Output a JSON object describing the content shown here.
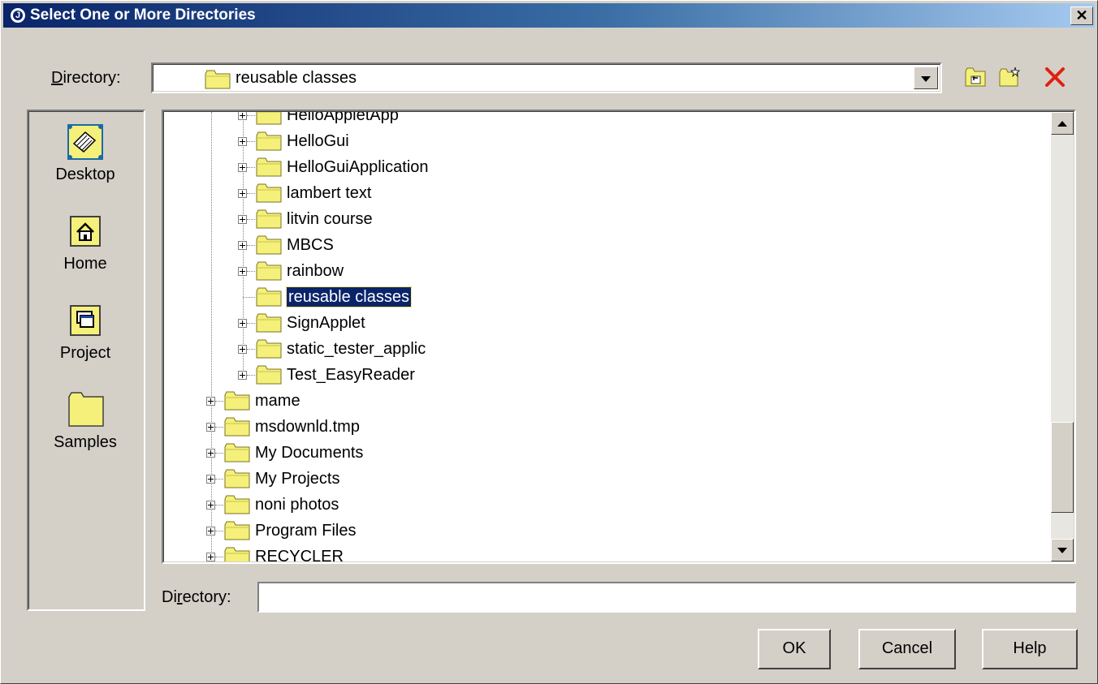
{
  "window": {
    "title": "Select One or More Directories",
    "title_icon_letter": "J",
    "close_glyph": "✕"
  },
  "directory_bar": {
    "label_prefix": "",
    "label_mnemonic": "D",
    "label_rest": "irectory:",
    "selected": "reusable classes",
    "toolbar_icons": [
      "up-one-level-icon",
      "new-folder-icon",
      "delete-icon"
    ]
  },
  "places": [
    {
      "label": "Desktop",
      "icon": "desktop-icon"
    },
    {
      "label": "Home",
      "icon": "home-icon"
    },
    {
      "label": "Project",
      "icon": "project-icon"
    },
    {
      "label": "Samples",
      "icon": "samples-folder-icon"
    }
  ],
  "tree": {
    "items": [
      {
        "label": "HelloAppletApp",
        "level": 2,
        "expandable": true,
        "selected": false
      },
      {
        "label": "HelloGui",
        "level": 2,
        "expandable": true,
        "selected": false
      },
      {
        "label": "HelloGuiApplication",
        "level": 2,
        "expandable": true,
        "selected": false
      },
      {
        "label": "lambert text",
        "level": 2,
        "expandable": true,
        "selected": false
      },
      {
        "label": "litvin course",
        "level": 2,
        "expandable": true,
        "selected": false
      },
      {
        "label": "MBCS",
        "level": 2,
        "expandable": true,
        "selected": false
      },
      {
        "label": "rainbow",
        "level": 2,
        "expandable": true,
        "selected": false
      },
      {
        "label": "reusable classes",
        "level": 2,
        "expandable": false,
        "selected": true
      },
      {
        "label": "SignApplet",
        "level": 2,
        "expandable": true,
        "selected": false
      },
      {
        "label": "static_tester_applic",
        "level": 2,
        "expandable": true,
        "selected": false
      },
      {
        "label": "Test_EasyReader",
        "level": 2,
        "expandable": true,
        "selected": false
      },
      {
        "label": "mame",
        "level": 1,
        "expandable": true,
        "selected": false
      },
      {
        "label": "msdownld.tmp",
        "level": 1,
        "expandable": true,
        "selected": false
      },
      {
        "label": "My Documents",
        "level": 1,
        "expandable": true,
        "selected": false
      },
      {
        "label": "My Projects",
        "level": 1,
        "expandable": true,
        "selected": false
      },
      {
        "label": "noni photos",
        "level": 1,
        "expandable": true,
        "selected": false
      },
      {
        "label": "Program Files",
        "level": 1,
        "expandable": true,
        "selected": false
      },
      {
        "label": "RECYCLER",
        "level": 1,
        "expandable": true,
        "selected": false
      }
    ]
  },
  "directory_field": {
    "label_prefix": "Di",
    "label_mnemonic": "r",
    "label_rest": "ectory:",
    "value": ""
  },
  "buttons": {
    "ok": "OK",
    "cancel": "Cancel",
    "help": "Help"
  },
  "colors": {
    "selection_bg": "#0a246a",
    "folder_yellow": "#f4f07a",
    "delete_red": "#e02010"
  }
}
